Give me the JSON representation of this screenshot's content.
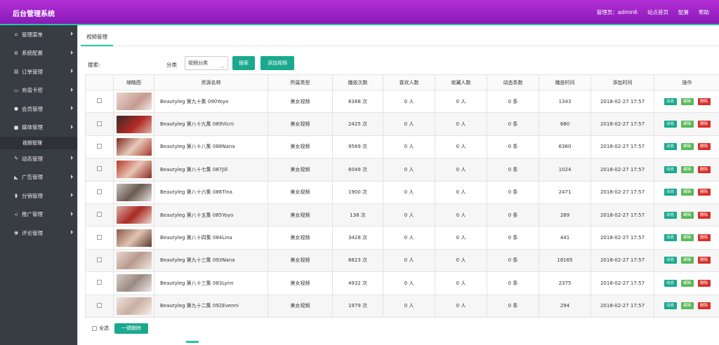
{
  "header": {
    "title": "后台管理系统",
    "admin_label": "管理员：admin6",
    "home_label": "站点首页",
    "config_label": "配置",
    "help_label": "帮助"
  },
  "sidebar": {
    "items": [
      {
        "icon": "home-icon",
        "label": "管理菜单"
      },
      {
        "icon": "gears-icon",
        "label": "系统配置"
      },
      {
        "icon": "bar-chart-icon",
        "label": "订单管理"
      },
      {
        "icon": "credit-card-icon",
        "label": "充值卡密"
      },
      {
        "icon": "user-icon",
        "label": "会员管理"
      },
      {
        "icon": "video-icon",
        "label": "媒体管理",
        "sub": "视频管理"
      },
      {
        "icon": "edit-icon",
        "label": "动态管理"
      },
      {
        "icon": "megaphone-icon",
        "label": "广告管理"
      },
      {
        "icon": "bookmark-icon",
        "label": "分销管理"
      },
      {
        "icon": "share-icon",
        "label": "推广管理"
      },
      {
        "icon": "comment-icon",
        "label": "评论管理"
      }
    ]
  },
  "tab": {
    "label": "视频管理"
  },
  "toolbar": {
    "search_label": "搜索:",
    "category_label": "分类",
    "category_value": "视频分类",
    "search_button": "搜索",
    "add_button": "添加视频"
  },
  "table": {
    "columns": [
      "缩略图",
      "资源名称",
      "所属类型",
      "播放次数",
      "喜欢人数",
      "收藏人数",
      "动态条数",
      "播放时间",
      "添加时间",
      "操作"
    ],
    "op_labels": {
      "dynamic": "动态",
      "edit": "编辑",
      "delete": "删除"
    },
    "rows": [
      {
        "name": "Beautyleg 第九十集 090Yoyo",
        "type": "美女视频",
        "plays": "8388 次",
        "likes": "0 人",
        "favs": "0 人",
        "dyn": "0 条",
        "duration": "1343",
        "added": "2018-02-27 17:57"
      },
      {
        "name": "Beautyleg 第八十九集 089Vicni",
        "type": "美女视频",
        "plays": "2425 次",
        "likes": "0 人",
        "favs": "0 人",
        "dyn": "0 条",
        "duration": "680",
        "added": "2018-02-27 17:57"
      },
      {
        "name": "Beautyleg 第八十八集 088Nana",
        "type": "美女视频",
        "plays": "9569 次",
        "likes": "0 人",
        "favs": "0 人",
        "dyn": "0 条",
        "duration": "6360",
        "added": "2018-02-27 17:57"
      },
      {
        "name": "Beautyleg 第八十七集 087Jill",
        "type": "美女视频",
        "plays": "6049 次",
        "likes": "0 人",
        "favs": "0 人",
        "dyn": "0 条",
        "duration": "1024",
        "added": "2018-02-27 17:57"
      },
      {
        "name": "Beautyleg 第八十六集 086Tina",
        "type": "美女视频",
        "plays": "1900 次",
        "likes": "0 人",
        "favs": "0 人",
        "dyn": "0 条",
        "duration": "2471",
        "added": "2018-02-27 17:57"
      },
      {
        "name": "Beautyleg 第八十五集 085Yoyo",
        "type": "美女视频",
        "plays": "138 次",
        "likes": "0 人",
        "favs": "0 人",
        "dyn": "0 条",
        "duration": "289",
        "added": "2018-02-27 17:57"
      },
      {
        "name": "Beautyleg 第八十四集 084Lina",
        "type": "美女视频",
        "plays": "3428 次",
        "likes": "0 人",
        "favs": "0 人",
        "dyn": "0 条",
        "duration": "441",
        "added": "2018-02-27 17:57"
      },
      {
        "name": "Beautyleg 第九十三集 093Nana",
        "type": "美女视频",
        "plays": "6823 次",
        "likes": "0 人",
        "favs": "0 人",
        "dyn": "0 条",
        "duration": "18165",
        "added": "2018-02-27 17:57"
      },
      {
        "name": "Beautyleg 第八十三集 083Lynn",
        "type": "美女视频",
        "plays": "4932 次",
        "likes": "0 人",
        "favs": "0 人",
        "dyn": "0 条",
        "duration": "2375",
        "added": "2018-02-27 17:57"
      },
      {
        "name": "Beautyleg 第九十二集 092Evenni",
        "type": "美女视频",
        "plays": "1979 次",
        "likes": "0 人",
        "favs": "0 人",
        "dyn": "0 条",
        "duration": "294",
        "added": "2018-02-27 17:57"
      }
    ]
  },
  "footer": {
    "select_all": "全选",
    "bulk_delete": "一键删除"
  },
  "colors": {
    "header": "#9b27c9",
    "accent": "#1aa98e",
    "sidebar": "#383c43",
    "delete": "#d9302b",
    "edit": "#5cb85c"
  }
}
